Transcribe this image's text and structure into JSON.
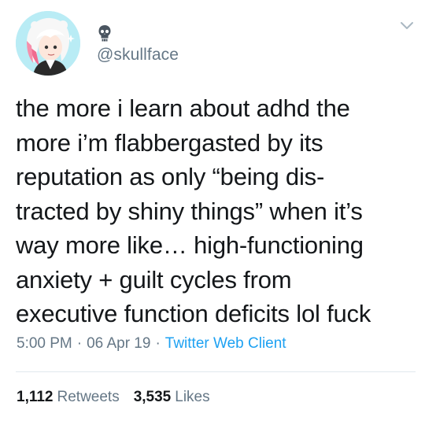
{
  "author": {
    "handle": "@skullface",
    "avatar_icon": "avatar-illustration",
    "name_icon": "skull-icon"
  },
  "menu_icon": "chevron-down-icon",
  "tweet": {
    "text": "the more i learn about adhd the\nmore i’m flabbergasted by its\nreputation as only “being dis-\ntracted by shiny things” when it’s\nway more like… high-functioning\nanxiety + guilt cycles from\nexecutive function deficits lol fuck",
    "time": "5:00 PM",
    "separator": "·",
    "date": "06 Apr 19",
    "client": "Twitter Web Client"
  },
  "stats": {
    "retweets_count": "1,112",
    "retweets_label": "Retweets",
    "likes_count": "3,535",
    "likes_label": "Likes"
  },
  "colors": {
    "text": "#14171a",
    "secondary": "#657786",
    "link": "#1da1f2",
    "divider": "#e1e8ed",
    "avatar_bg": "#b9ecf5"
  }
}
